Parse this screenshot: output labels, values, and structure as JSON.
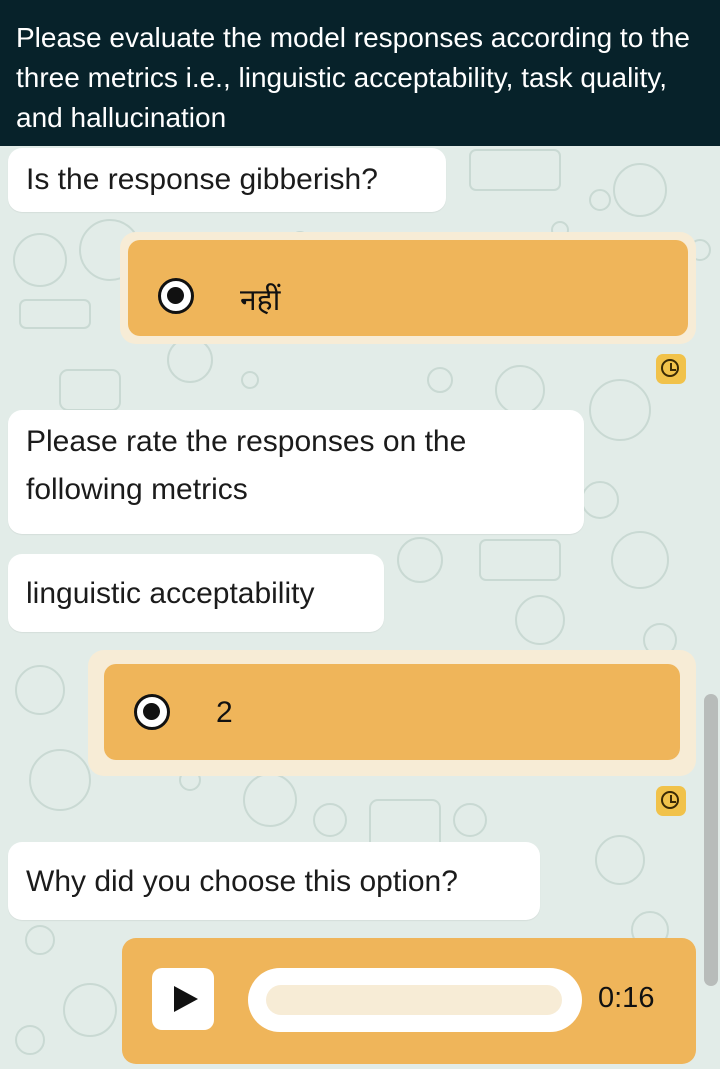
{
  "messages": {
    "instruction": "Please evaluate the model responses according to the three metrics i.e., linguistic acceptability, task quality, and hallucination",
    "gibberish_question": "Is the response gibberish?",
    "gibberish_answer": "नहीं",
    "rate_prompt": "Please rate the responses on the following metrics",
    "metric_label": "linguistic acceptability",
    "metric_answer": "2",
    "why_question": "Why did you choose this option?"
  },
  "audio": {
    "duration": "0:16"
  },
  "colors": {
    "header_bg": "#07222a",
    "choice_bg": "#efb55a",
    "choice_outer": "#f7ecd6",
    "chat_bg": "#e2ece8",
    "clock_icon": "#f1c24a"
  }
}
